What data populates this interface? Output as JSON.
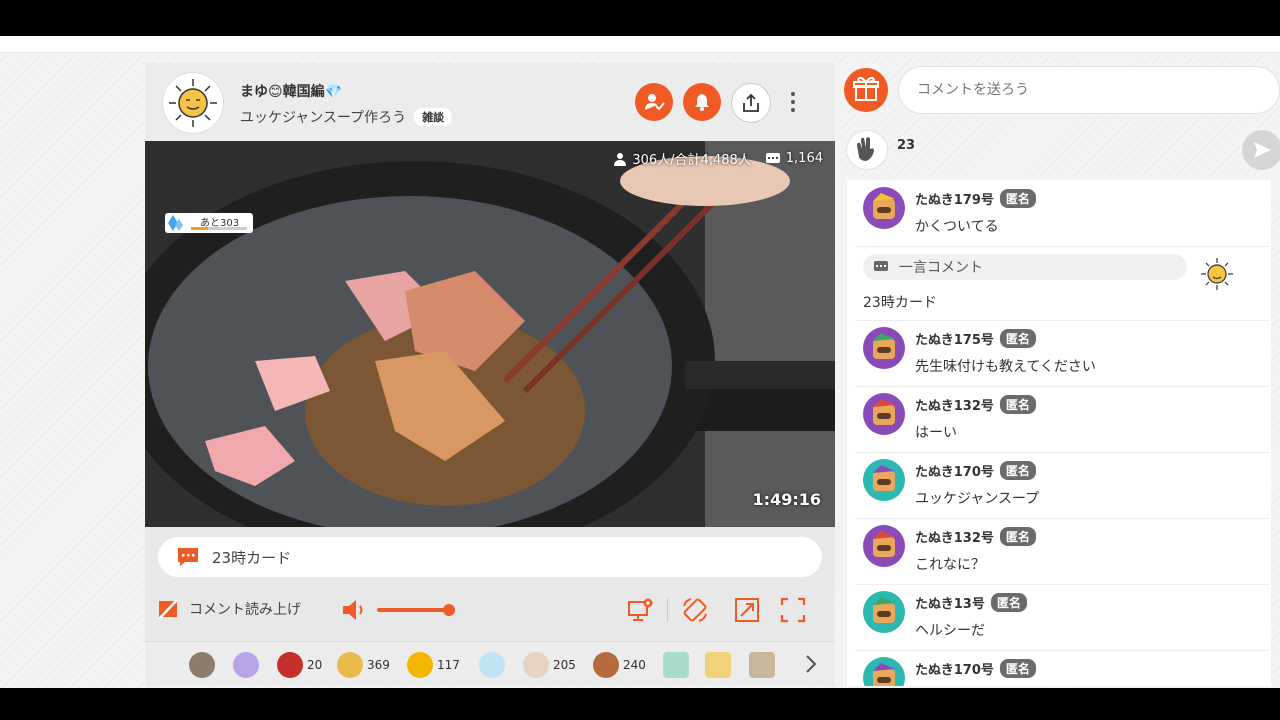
{
  "streamer": {
    "name": "まゆ😊韓国編💎",
    "title": "ユッケジャンスープ作ろう",
    "category": "雑談"
  },
  "stats": {
    "viewers": "306人/合計4,488人",
    "comments": "1,164"
  },
  "level_badge": "あと303",
  "duration": "1:49:16",
  "pinned_comment": "23時カード",
  "controls": {
    "read_aloud": "コメント読み上げ",
    "volume_level": 0.8
  },
  "gifts": [
    {
      "icon": "raccoon-gift-icon",
      "count": ""
    },
    {
      "icon": "glitter-ball-gift-icon",
      "count": ""
    },
    {
      "icon": "santa-gift-icon",
      "count": "20"
    },
    {
      "icon": "cake-gift-icon",
      "count": "369"
    },
    {
      "icon": "horn-gift-icon",
      "count": "117"
    },
    {
      "icon": "bubble-gift-icon",
      "count": ""
    },
    {
      "icon": "mouse-gift-icon",
      "count": "205"
    },
    {
      "icon": "bear-gift-icon",
      "count": "240"
    },
    {
      "icon": "card-gift-icon",
      "count": ""
    },
    {
      "icon": "scroll-gift-icon",
      "count": ""
    },
    {
      "icon": "bag-gift-icon",
      "count": ""
    }
  ],
  "comment_input_placeholder": "コメントを送ろう",
  "clap_count": "23",
  "hitokoto": {
    "label": "一言コメント",
    "value": "23時カード"
  },
  "anon_badge": "匿名",
  "messages": [
    {
      "name": "たぬき179号",
      "text": "かくついてる",
      "color": "#8a4bb8"
    },
    {
      "name": "たぬき175号",
      "text": "先生味付けも教えてください",
      "color": "#8a4bb8"
    },
    {
      "name": "たぬき132号",
      "text": "はーい",
      "color": "#8a4bb8"
    },
    {
      "name": "たぬき170号",
      "text": "ユッケジャンスープ",
      "color": "#2cb8b0"
    },
    {
      "name": "たぬき132号",
      "text": "これなに？",
      "color": "#8a4bb8"
    },
    {
      "name": "たぬき13号",
      "text": "ヘルシーだ",
      "color": "#2cb8b0"
    },
    {
      "name": "たぬき170号",
      "text": "",
      "color": "#2cb8b0"
    }
  ],
  "colors": {
    "accent": "#f05a24",
    "anon_badge": "#6b6b6b"
  }
}
